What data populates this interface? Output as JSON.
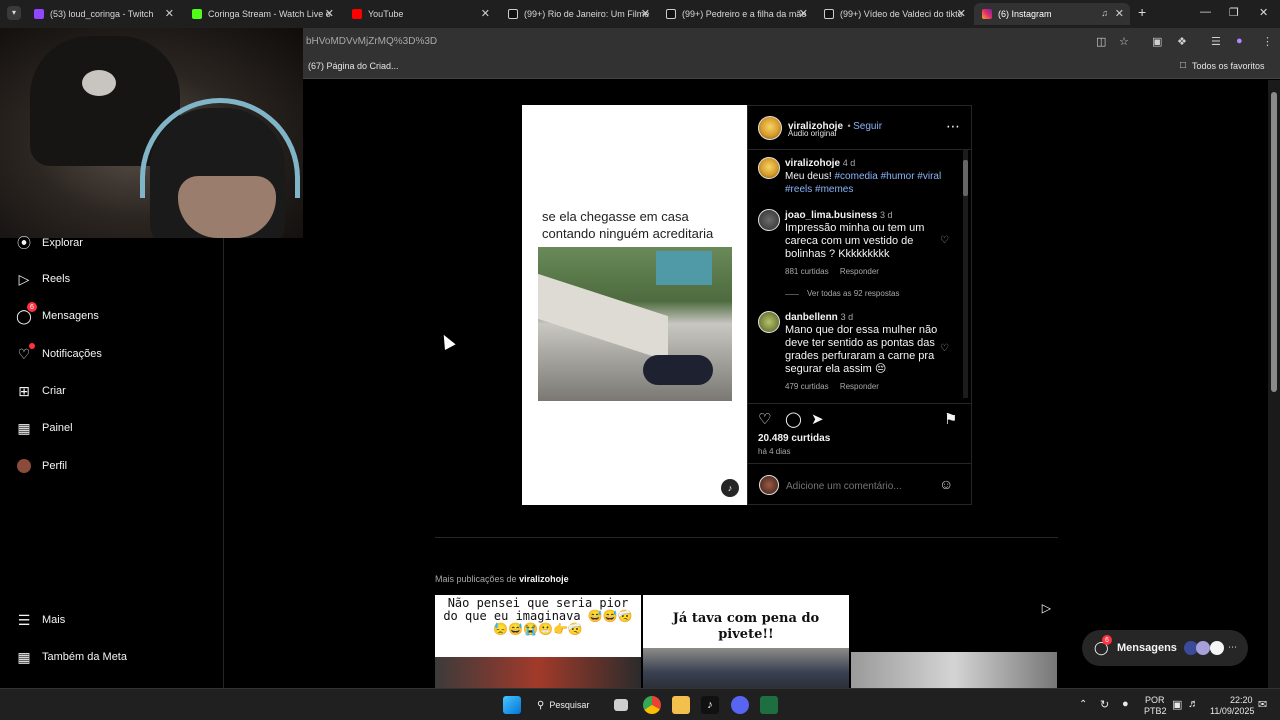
{
  "browser": {
    "tabs": [
      {
        "label": "(53) loud_coringa - Twitch",
        "icon": "twitch-icon",
        "color": "#9146ff"
      },
      {
        "label": "Coringa Stream - Watch Live o",
        "icon": "kick-icon",
        "color": "#53fc18"
      },
      {
        "label": "YouTube",
        "icon": "youtube-icon",
        "color": "#ff0000"
      },
      {
        "label": "(99+) Rio de Janeiro: Um Filme",
        "icon": "tiktok-icon",
        "color": "#ffffff"
      },
      {
        "label": "(99+) Pedreiro e a filha da mãe",
        "icon": "tiktok-icon",
        "color": "#ffffff"
      },
      {
        "label": "(99+) Vídeo de Valdeci do tikto",
        "icon": "tiktok-icon",
        "color": "#ffffff"
      },
      {
        "label": "(6) Instagram",
        "icon": "instagram-icon",
        "color": "#e1306c"
      }
    ],
    "url": "bHVoMDVvMjZrMQ%3D%3D",
    "bookmarks": {
      "left": "(67) Página do Criad...",
      "right": "Todos os favoritos"
    }
  },
  "nav": {
    "items": [
      {
        "label": "Explorar",
        "icon": "compass-icon"
      },
      {
        "label": "Reels",
        "icon": "reels-icon"
      },
      {
        "label": "Mensagens",
        "icon": "messenger-icon",
        "badge": "6"
      },
      {
        "label": "Notificações",
        "icon": "heart-icon"
      },
      {
        "label": "Criar",
        "icon": "plus-square-icon"
      },
      {
        "label": "Painel",
        "icon": "dashboard-icon"
      },
      {
        "label": "Perfil",
        "icon": "profile-avatar"
      }
    ],
    "more": "Mais",
    "meta": "Também da Meta"
  },
  "post": {
    "caption_text": "se ela chegasse em casa contando ninguém acreditaria",
    "author": "viralizohoje",
    "follow": "Seguir",
    "audio": "Áudio original",
    "description": {
      "user": "viralizohoje",
      "time": "4 d",
      "text_plain": "Meu deus!",
      "tags_line1": "#comedia #humor #viral",
      "tags_line2": "#reels #memes"
    },
    "comments": [
      {
        "user": "joao_lima.business",
        "time": "3 d",
        "text": "Impressão minha ou tem um careca com um vestido de bolinhas ? Kkkkkkkkk",
        "likes": "881 curtidas",
        "reply": "Responder",
        "view_replies": "Ver todas as 92 respostas"
      },
      {
        "user": "danbellenn",
        "time": "3 d",
        "text": "Mano que dor essa mulher não deve ter sentido as pontas das grades perfuraram a carne pra segurar ela assim 😔",
        "likes": "479 curtidas",
        "reply": "Responder"
      }
    ],
    "likes": "20.489 curtidas",
    "posted": "há 4 dias",
    "comment_placeholder": "Adicione um comentário..."
  },
  "more_posts": {
    "label": "Mais publicações de",
    "user": "viralizohoje",
    "thumbs": [
      {
        "text": "Não pensei que seria pior do que eu imaginava 😅😅🤕😓😅😭😬👉🤕"
      },
      {
        "text": "Já tava com pena do pivete!!"
      },
      {
        "text": ""
      }
    ]
  },
  "messages_pill": {
    "label": "Mensagens",
    "badge": "6"
  },
  "taskbar": {
    "search": "Pesquisar",
    "lang1": "POR",
    "lang2": "PTB2",
    "time": "22:20",
    "date": "11/09/2025"
  }
}
